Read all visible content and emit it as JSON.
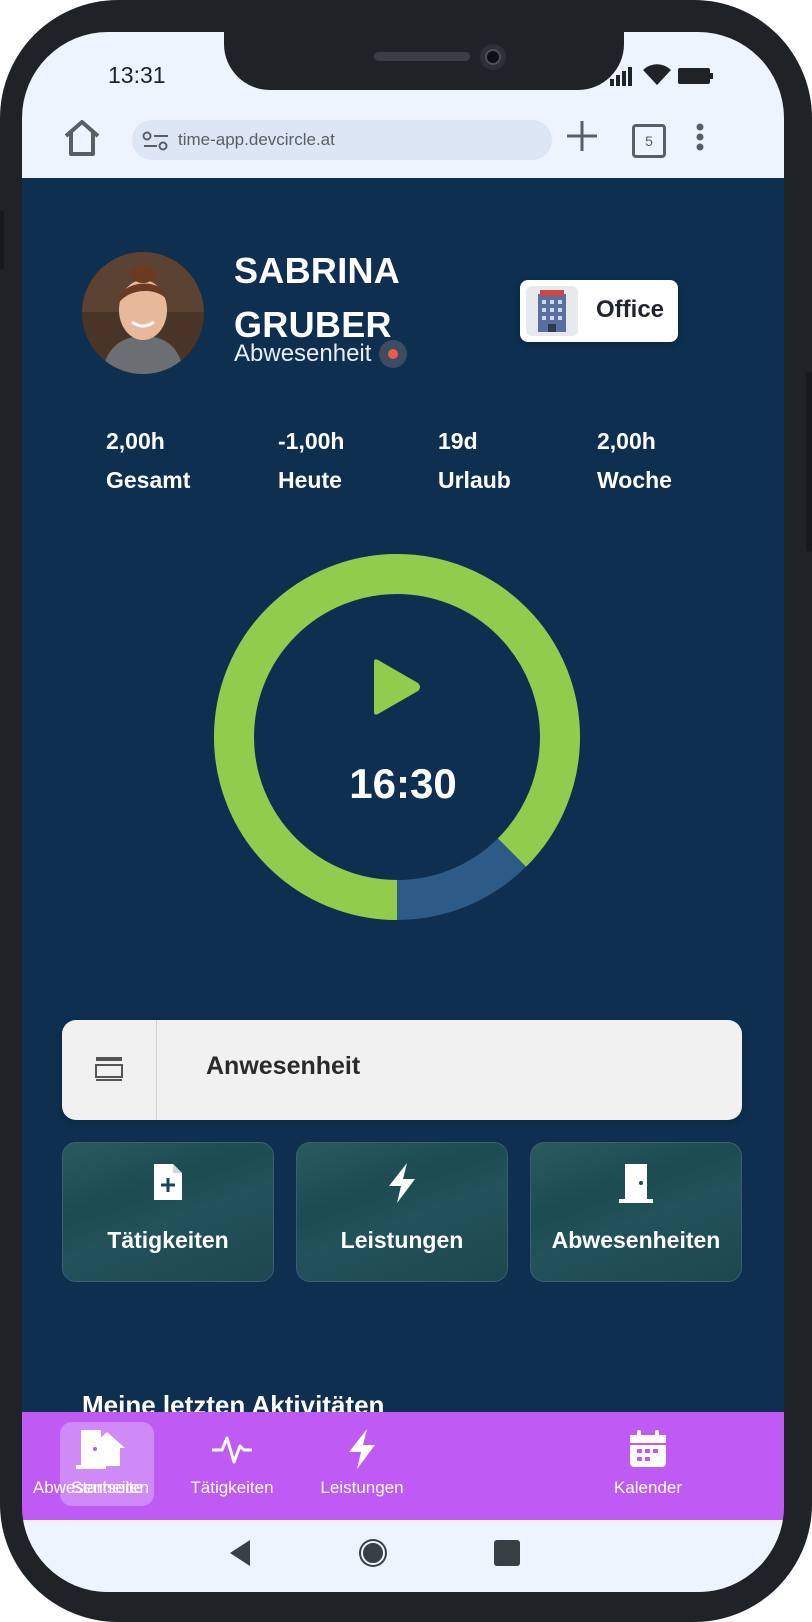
{
  "statusbar": {
    "time": "13:31"
  },
  "browser": {
    "url": "time-app.devcircle.at",
    "tab_count": "5"
  },
  "profile": {
    "first_name": "SABRINA",
    "last_name": "GRUBER",
    "status_text": "Abwesenheit",
    "status_color": "#ef5a4a",
    "location_label": "Office"
  },
  "stats": [
    {
      "value": "2,00h",
      "label": "Gesamt"
    },
    {
      "value": "-1,00h",
      "label": "Heute"
    },
    {
      "value": "19d",
      "label": "Urlaub"
    },
    {
      "value": "2,00h",
      "label": "Woche"
    }
  ],
  "timer": {
    "display": "16:30",
    "progress_green_fraction": 0.875,
    "ring_green": "#92cc4c",
    "ring_blue": "#2d5a86"
  },
  "presence": {
    "label": "Anwesenheit"
  },
  "quick_actions": [
    {
      "label": "Tätigkeiten",
      "icon": "document-add-icon"
    },
    {
      "label": "Leistungen",
      "icon": "lightning-icon"
    },
    {
      "label": "Abwesenheiten",
      "icon": "door-icon"
    }
  ],
  "section": {
    "title": "Meine letzten Aktivitäten"
  },
  "bottom_nav": [
    {
      "label": "Startseite",
      "icon": "home-icon",
      "active": true
    },
    {
      "label": "Tätigkeiten",
      "icon": "activity-icon",
      "active": false
    },
    {
      "label": "Leistungen",
      "icon": "lightning-icon",
      "active": false
    },
    {
      "label": "Abwesenheiten",
      "icon": "door-icon",
      "active": false
    },
    {
      "label": "Kalender",
      "icon": "calendar-icon",
      "active": false
    }
  ],
  "colors": {
    "app_bg": "#0e2f4f",
    "nav_bg": "#bf5af5",
    "accent_green": "#92cc4c"
  }
}
